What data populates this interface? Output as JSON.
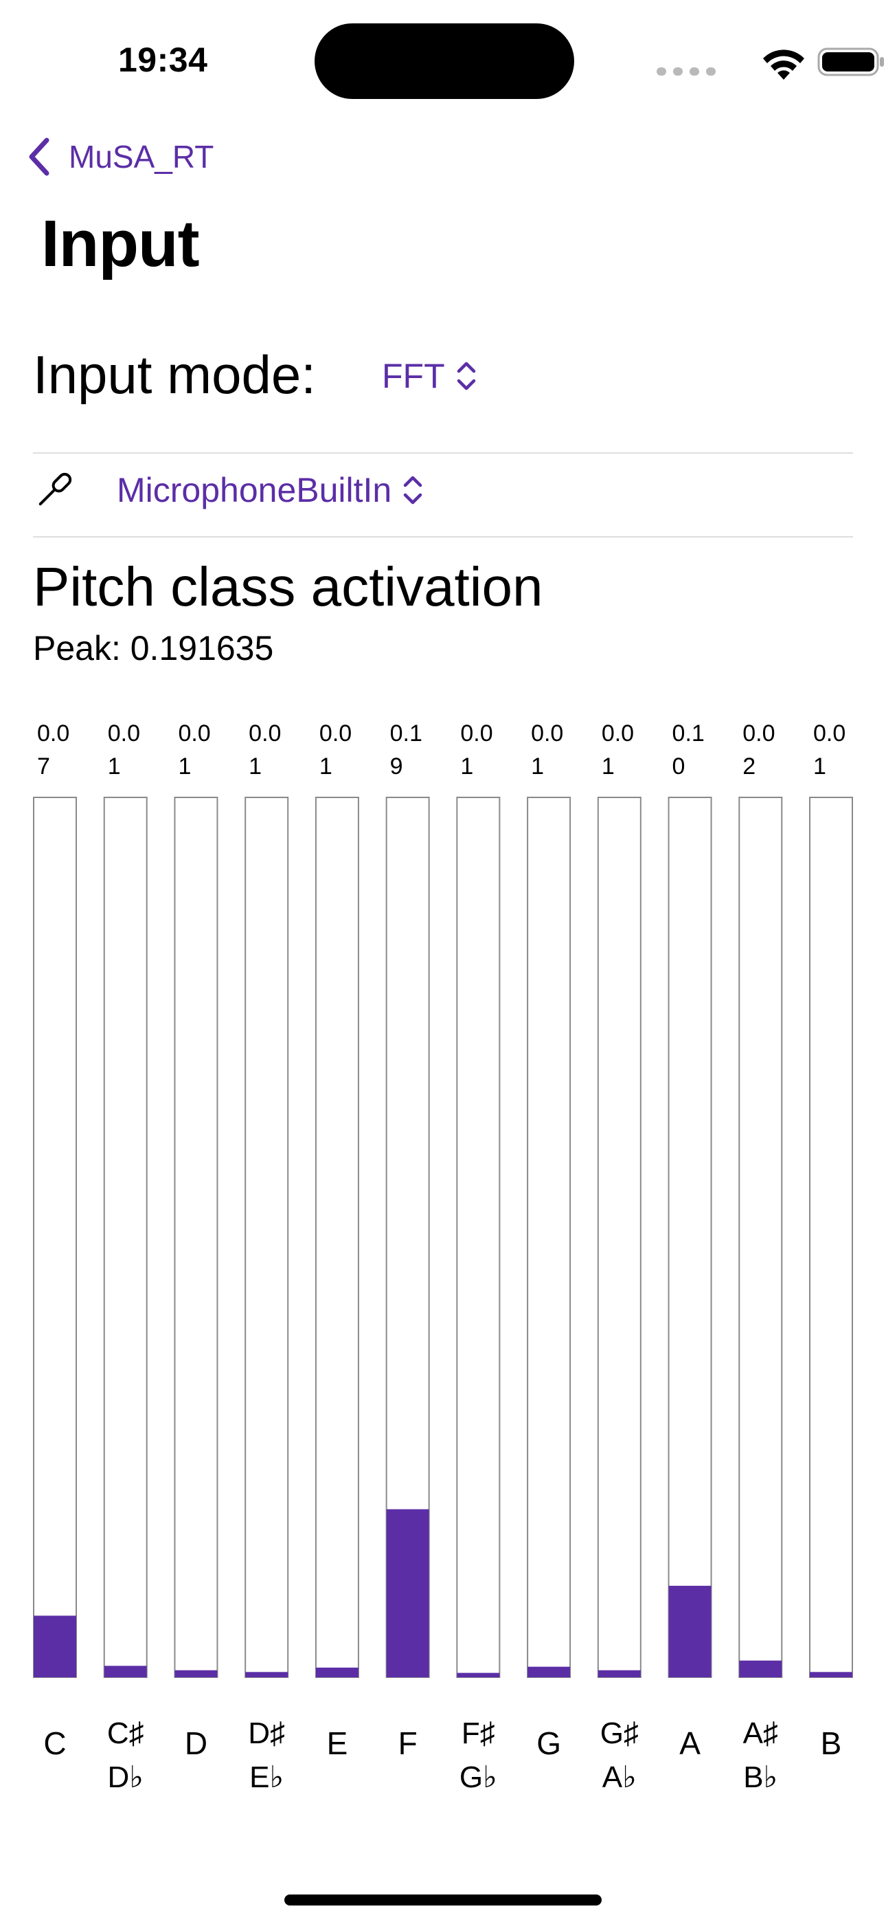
{
  "status_bar": {
    "time": "19:34"
  },
  "nav": {
    "back_label": "MuSA_RT"
  },
  "page": {
    "title": "Input"
  },
  "input_mode": {
    "label": "Input mode:",
    "value": "FFT"
  },
  "device": {
    "value": "MicrophoneBuiltIn"
  },
  "section": {
    "title": "Pitch class activation",
    "peak": "Peak: 0.191635"
  },
  "colors": {
    "accent": "#5b2ea6",
    "bar_fill": "#5b2ea6",
    "bar_border": "#8a8a8a"
  },
  "icons": {
    "back": "chevron-left-icon",
    "picker": "chevron-up-down-icon",
    "device": "microphone-icon",
    "wifi": "wifi-icon",
    "battery": "battery-icon"
  },
  "chart_data": {
    "type": "bar",
    "categories": [
      "C",
      "C♯ D♭",
      "D",
      "D♯ E♭",
      "E",
      "F",
      "F♯ G♭",
      "G",
      "G♯ A♭",
      "A",
      "A♯ B♭",
      "B"
    ],
    "labels": [
      [
        "C"
      ],
      [
        "C♯",
        "D♭"
      ],
      [
        "D"
      ],
      [
        "D♯",
        "E♭"
      ],
      [
        "E"
      ],
      [
        "F"
      ],
      [
        "F♯",
        "G♭"
      ],
      [
        "G"
      ],
      [
        "G♯",
        "A♭"
      ],
      [
        "A"
      ],
      [
        "A♯",
        "B♭"
      ],
      [
        "B"
      ]
    ],
    "value_labels": [
      [
        "0.0",
        "7"
      ],
      [
        "0.0",
        "1"
      ],
      [
        "0.0",
        "1"
      ],
      [
        "0.0",
        "1"
      ],
      [
        "0.0",
        "1"
      ],
      [
        "0.1",
        "9"
      ],
      [
        "0.0",
        "1"
      ],
      [
        "0.0",
        "1"
      ],
      [
        "0.0",
        "1"
      ],
      [
        "0.1",
        "0"
      ],
      [
        "0.0",
        "2"
      ],
      [
        "0.0",
        "1"
      ]
    ],
    "values": [
      0.07,
      0.013,
      0.008,
      0.006,
      0.011,
      0.191,
      0.005,
      0.012,
      0.008,
      0.104,
      0.019,
      0.006
    ],
    "ylim": [
      0,
      1
    ]
  }
}
